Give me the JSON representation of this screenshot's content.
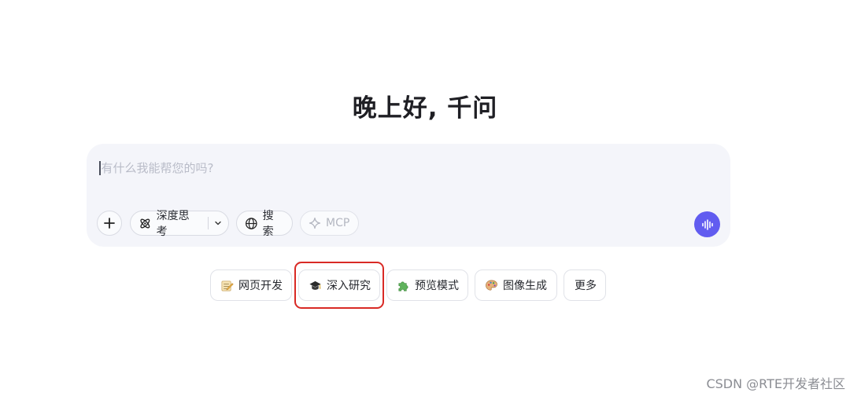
{
  "greeting": "晚上好, 千问",
  "composer": {
    "placeholder": "有什么我能帮您的吗?",
    "toolbar": {
      "add_icon": "plus-icon",
      "deep_think_label": "深度思考",
      "deep_think_icon": "atom-icon",
      "search_label": "搜索",
      "search_icon": "globe-icon",
      "mcp_label": "MCP",
      "mcp_icon": "sparkle-icon"
    },
    "voice_icon": "voice-wave-icon",
    "accent_color": "#615cf0"
  },
  "quick_actions": [
    {
      "label": "网页开发",
      "icon": "memo-icon"
    },
    {
      "label": "深入研究",
      "icon": "graduation-cap-icon",
      "highlighted": true
    },
    {
      "label": "预览模式",
      "icon": "puzzle-icon"
    },
    {
      "label": "图像生成",
      "icon": "palette-icon"
    },
    {
      "label": "更多",
      "icon": ""
    }
  ],
  "highlight_color": "#d92a25",
  "watermark": "CSDN @RTE开发者社区"
}
